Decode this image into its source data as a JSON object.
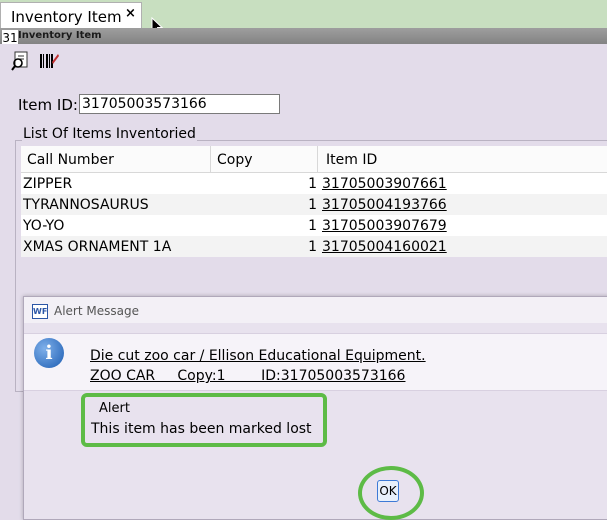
{
  "tab": {
    "label": "Inventory Item",
    "close_glyph": "×"
  },
  "window": {
    "title": "Inventory Item",
    "icon_text": "31"
  },
  "toolbar": {
    "tools": [
      "magnifier-document-icon",
      "barcode-icon"
    ]
  },
  "item_id": {
    "label": "Item ID:",
    "value": "31705003573166"
  },
  "list": {
    "legend": "List Of Items Inventoried",
    "columns": [
      "Call Number",
      "Copy",
      "Item ID"
    ],
    "rows": [
      {
        "call_number": "ZIPPER",
        "copy": "1",
        "item_id": "31705003907661"
      },
      {
        "call_number": "TYRANNOSAURUS",
        "copy": "1",
        "item_id": "31705004193766"
      },
      {
        "call_number": "YO-YO",
        "copy": "1",
        "item_id": "31705003907679"
      },
      {
        "call_number": "XMAS ORNAMENT 1A",
        "copy": "1",
        "item_id": "31705004160021"
      }
    ]
  },
  "dialog": {
    "title": "Alert Message",
    "app_icon_text": "WF",
    "info_icon_glyph": "i",
    "line1": "Die cut zoo car / Ellison Educational Equipment.",
    "line2": "ZOO CAR     Copy:1        ID:31705003573166",
    "alert_label": "Alert",
    "alert_text": "This item has been marked lost",
    "ok_label": "OK"
  },
  "colors": {
    "highlight_green": "#5dbb46",
    "tab_strip": "#c8dfc0",
    "panel": "#e3dcea"
  }
}
